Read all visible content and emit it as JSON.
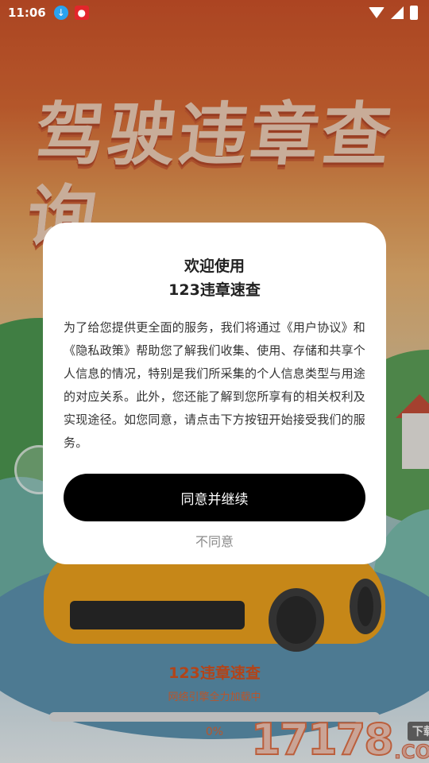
{
  "status_bar": {
    "time": "11:06"
  },
  "hero": {
    "title": "驾驶违章查询"
  },
  "dialog": {
    "title_line1": "欢迎使用",
    "title_line2": "123违章速查",
    "body": "为了给您提供更全面的服务，我们将通过《用户协议》和《隐私政策》帮助您了解我们收集、使用、存储和共享个人信息的情况，特别是我们所采集的个人信息类型与用途的对应关系。此外，您还能了解到您所享有的相关权利及实现途径。如您同意，请点击下方按钮开始接受我们的服务。",
    "agree_label": "同意并继续",
    "disagree_label": "不同意"
  },
  "loading": {
    "app_name": "123违章速查",
    "message": "网络引擎全力加载中",
    "progress_percent": 0,
    "progress_text": "0%"
  },
  "watermark": {
    "number": "17178",
    "badge": "下载站",
    "domain": ".COM"
  },
  "colors": {
    "accent": "#e06a36",
    "button_bg": "#000000"
  }
}
